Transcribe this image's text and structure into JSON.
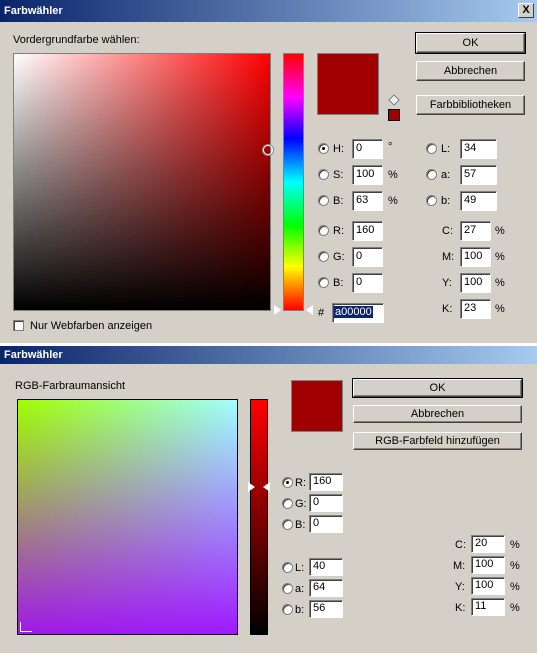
{
  "dialog1": {
    "title": "Farbwähler",
    "close": "X",
    "prompt": "Vordergrundfarbe wählen:",
    "ok": "OK",
    "cancel": "Abbrechen",
    "libraries": "Farbbibliotheken",
    "current_color": "#a00000",
    "hsb": [
      {
        "label": "H:",
        "value": "0",
        "unit": "°",
        "selected": true
      },
      {
        "label": "S:",
        "value": "100",
        "unit": "%",
        "selected": false
      },
      {
        "label": "B:",
        "value": "63",
        "unit": "%",
        "selected": false
      }
    ],
    "rgb": [
      {
        "label": "R:",
        "value": "160"
      },
      {
        "label": "G:",
        "value": "0"
      },
      {
        "label": "B:",
        "value": "0"
      }
    ],
    "lab": [
      {
        "label": "L:",
        "value": "34"
      },
      {
        "label": "a:",
        "value": "57"
      },
      {
        "label": "b:",
        "value": "49"
      }
    ],
    "cmyk": [
      {
        "label": "C:",
        "value": "27",
        "unit": "%"
      },
      {
        "label": "M:",
        "value": "100",
        "unit": "%"
      },
      {
        "label": "Y:",
        "value": "100",
        "unit": "%"
      },
      {
        "label": "K:",
        "value": "23",
        "unit": "%"
      }
    ],
    "hash": "#",
    "hex": "a00000",
    "web_only": "Nur Webfarben anzeigen",
    "web_only_checked": false
  },
  "dialog2": {
    "title": "Farbwähler",
    "view_label": "RGB-Farbraumansicht",
    "ok": "OK",
    "cancel": "Abbrechen",
    "add_swatch": "RGB-Farbfeld hinzufügen",
    "current_color": "#a00000",
    "rgb": [
      {
        "label": "R:",
        "value": "160",
        "selected": true
      },
      {
        "label": "G:",
        "value": "0",
        "selected": false
      },
      {
        "label": "B:",
        "value": "0",
        "selected": false
      }
    ],
    "lab": [
      {
        "label": "L:",
        "value": "40"
      },
      {
        "label": "a:",
        "value": "64"
      },
      {
        "label": "b:",
        "value": "56"
      }
    ],
    "cmyk": [
      {
        "label": "C:",
        "value": "20",
        "unit": "%"
      },
      {
        "label": "M:",
        "value": "100",
        "unit": "%"
      },
      {
        "label": "Y:",
        "value": "100",
        "unit": "%"
      },
      {
        "label": "K:",
        "value": "11",
        "unit": "%"
      }
    ]
  }
}
